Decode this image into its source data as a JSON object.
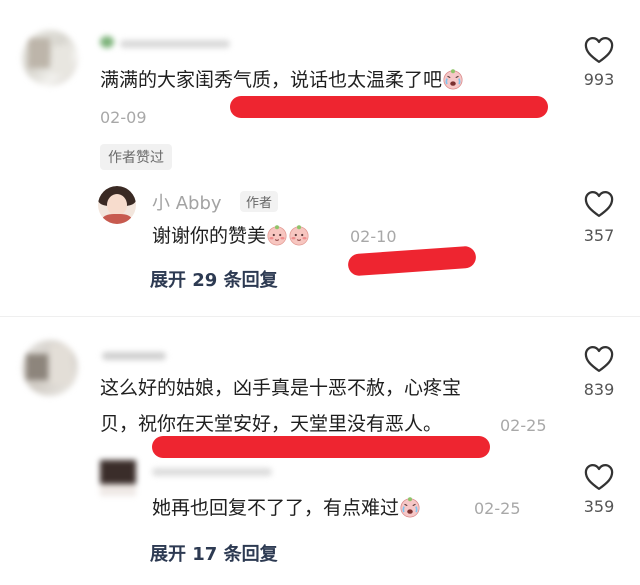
{
  "comments": [
    {
      "text": "满满的大家闺秀气质，说话也太温柔了吧",
      "date": "02-09",
      "liked_by_author_tag": "作者赞过",
      "likes": "993"
    },
    {
      "text_line1": "这么好的姑娘，凶手真是十恶不赦，心疼宝",
      "text_line2": "贝，祝你在天堂安好，天堂里没有恶人。",
      "date": "02-25",
      "likes": "839"
    }
  ],
  "replies": [
    {
      "name": "小 Abby",
      "tag": "作者",
      "text": "谢谢你的赞美",
      "date": "02-10",
      "likes": "357",
      "expand_label": "展开 29 条回复"
    },
    {
      "text": "她再也回复不了了，有点难过",
      "date": "02-25",
      "likes": "359",
      "expand_label": "展开 17 条回复"
    }
  ],
  "icons": {
    "like": "heart-outline-icon",
    "emoji_cry": "crying-face-emoji",
    "emoji_blush": "blushing-face-emoji"
  },
  "colors": {
    "redaction": "#ee2530",
    "expand_text": "#2d3a52"
  }
}
